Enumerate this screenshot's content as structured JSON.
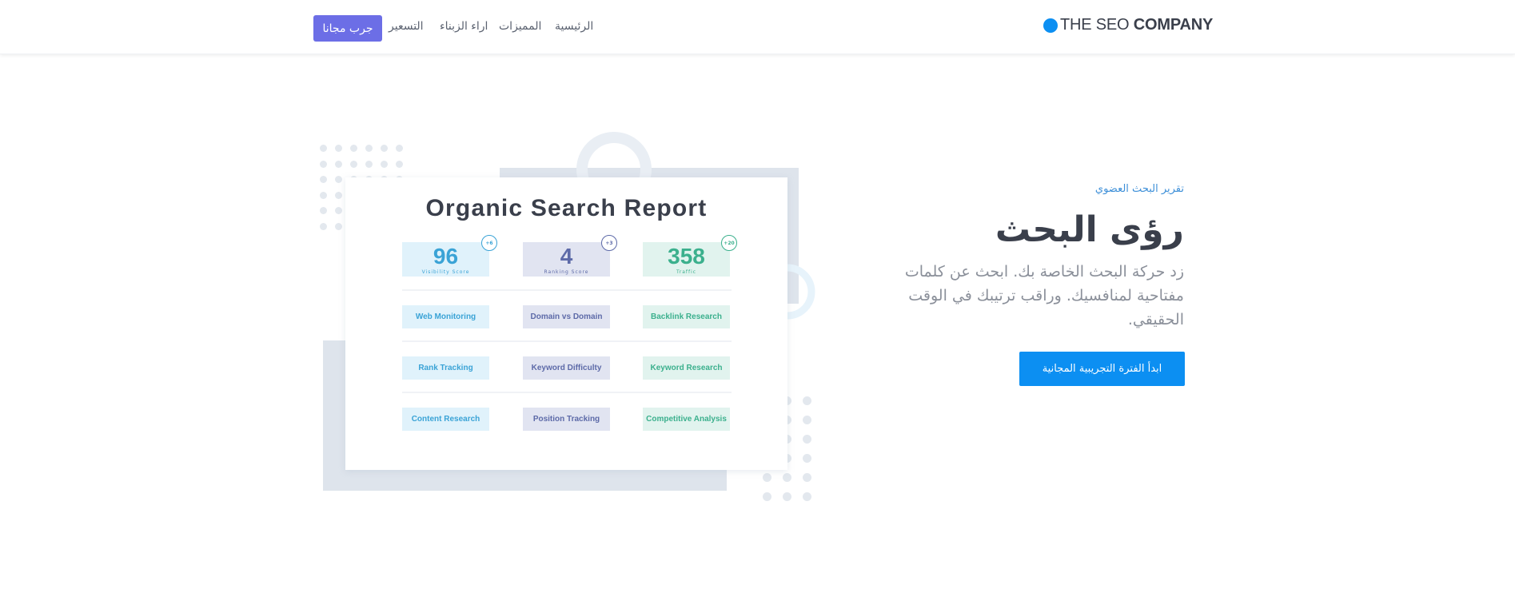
{
  "header": {
    "logo_light": "THE SEO",
    "logo_bold": "COMPANY",
    "nav": {
      "home": "الرئيسية",
      "features": "المميزات",
      "testimonials": "اراء الزبناء",
      "pricing": "التسعير"
    },
    "try_label": "جرب مجانا"
  },
  "hero": {
    "eyebrow": "تقرير البحث العضوي",
    "title": "رؤى البحث",
    "description": "زد حركة البحث الخاصة بك. ابحث عن كلمات مفتاحية لمنافسيك. وراقب ترتيبك في الوقت الحقيقي.",
    "cta_label": "ابدأ الفترة التجريبية المجانية"
  },
  "report": {
    "title": "Organic Search Report",
    "metrics": [
      {
        "value": "96",
        "label": "Visibility Score",
        "badge": "+6",
        "color": "#3aa3d6"
      },
      {
        "value": "4",
        "label": "Ranking Score",
        "badge": "+3",
        "color": "#5d6aa8"
      },
      {
        "value": "358",
        "label": "Traffic",
        "badge": "+20",
        "color": "#3bb08d"
      }
    ],
    "tools": [
      [
        "Web Monitoring",
        "Domain vs Domain",
        "Backlink Research"
      ],
      [
        "Rank Tracking",
        "Keyword Difficulty",
        "Keyword Research"
      ],
      [
        "Content Research",
        "Position Tracking",
        "Competitive Analysis"
      ]
    ]
  },
  "icons": {
    "logo": "blue-circle-icon"
  }
}
